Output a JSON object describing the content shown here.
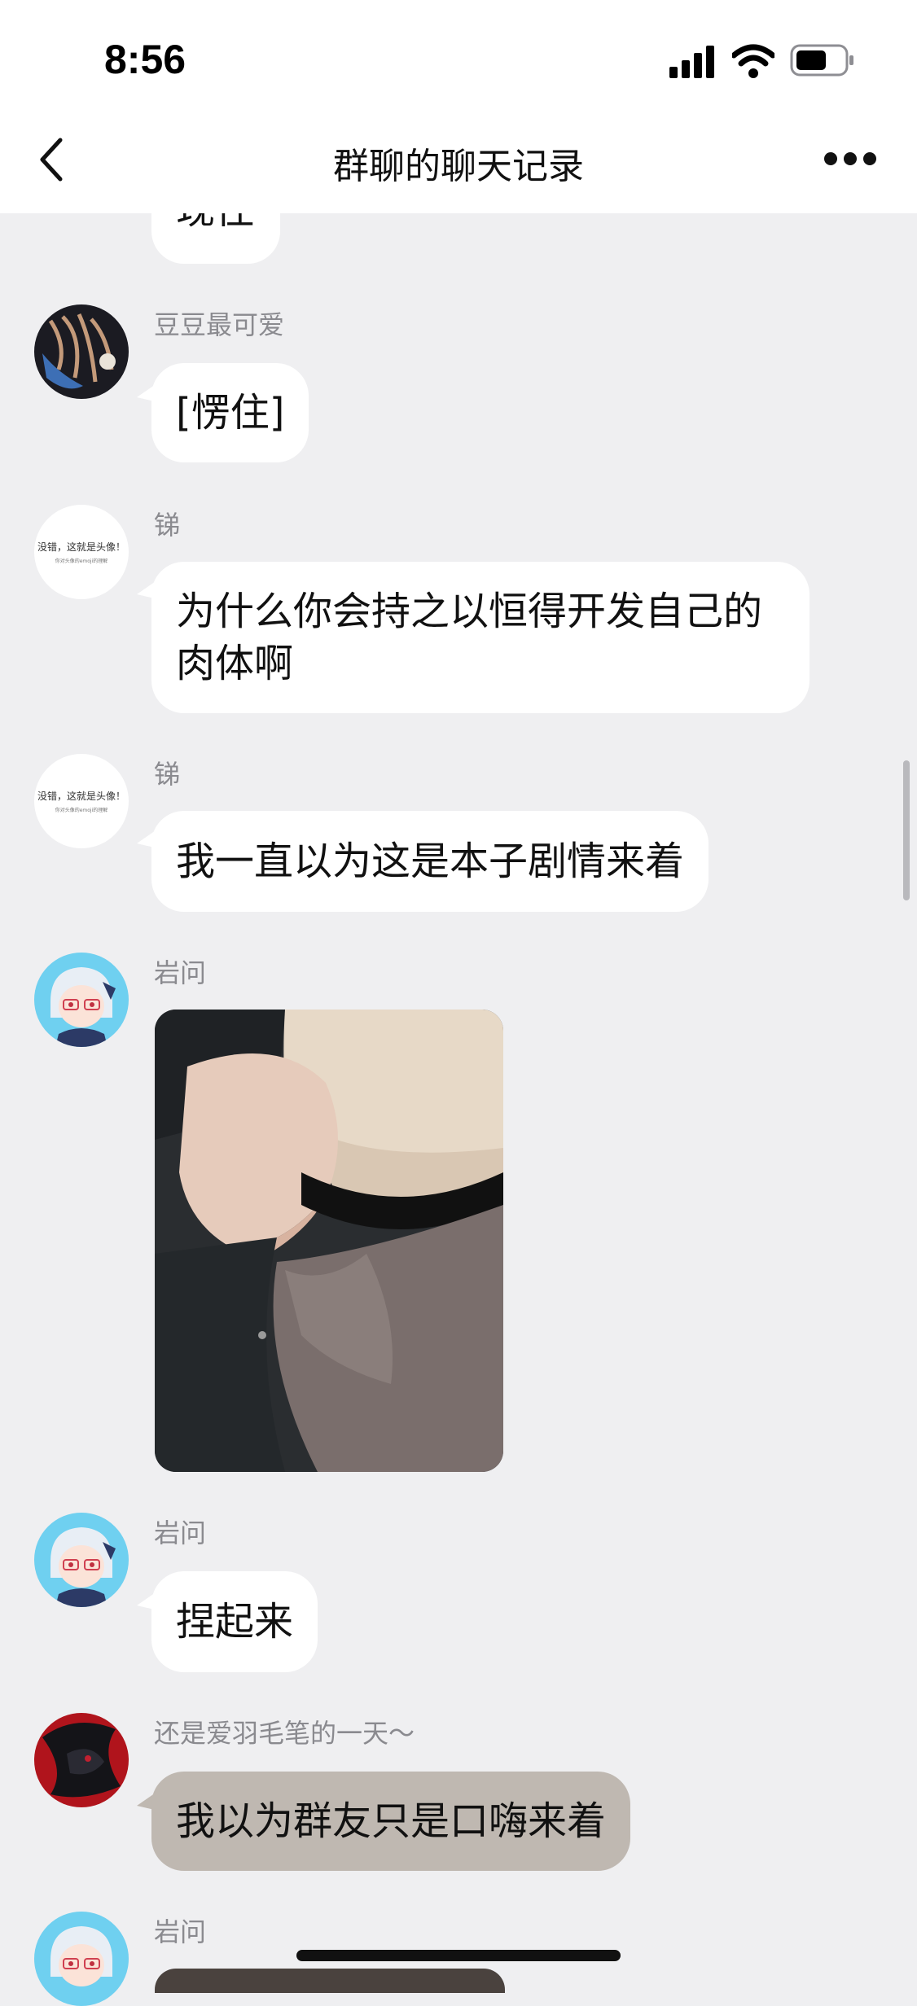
{
  "status_bar": {
    "time": "8:56",
    "icons": [
      "signal-icon",
      "wifi-icon",
      "battery-icon"
    ]
  },
  "nav": {
    "title": "群聊的聊天记录",
    "back_icon": "chevron-left-icon",
    "more_icon": "more-dots-icon"
  },
  "colors": {
    "bubble": "#ffffff",
    "quoted_bubble": "#bfb8b1",
    "background": "#efeff1",
    "sender": "#8a8a8f"
  },
  "messages": [
    {
      "text": "现住"
    },
    {
      "sender": "豆豆最可爱",
      "text": "[愣住]"
    },
    {
      "sender": "锑",
      "avatar_text": "没错，这就是头像！",
      "avatar_subtext": "你对头像的emoji的理解",
      "lines": [
        "为什么你会持之以恒得开发自己的",
        "肉体啊"
      ]
    },
    {
      "sender": "锑",
      "avatar_text": "没错，这就是头像！",
      "avatar_subtext": "你对头像的emoji的理解",
      "text": "我一直以为这是本子剧情来着"
    },
    {
      "sender": "岩问",
      "type": "image"
    },
    {
      "sender": "岩问",
      "text": "捏起来"
    },
    {
      "sender": "还是爱羽毛笔的一天～",
      "text": "我以为群友只是口嗨来着"
    },
    {
      "sender": "岩问",
      "type": "image"
    }
  ]
}
